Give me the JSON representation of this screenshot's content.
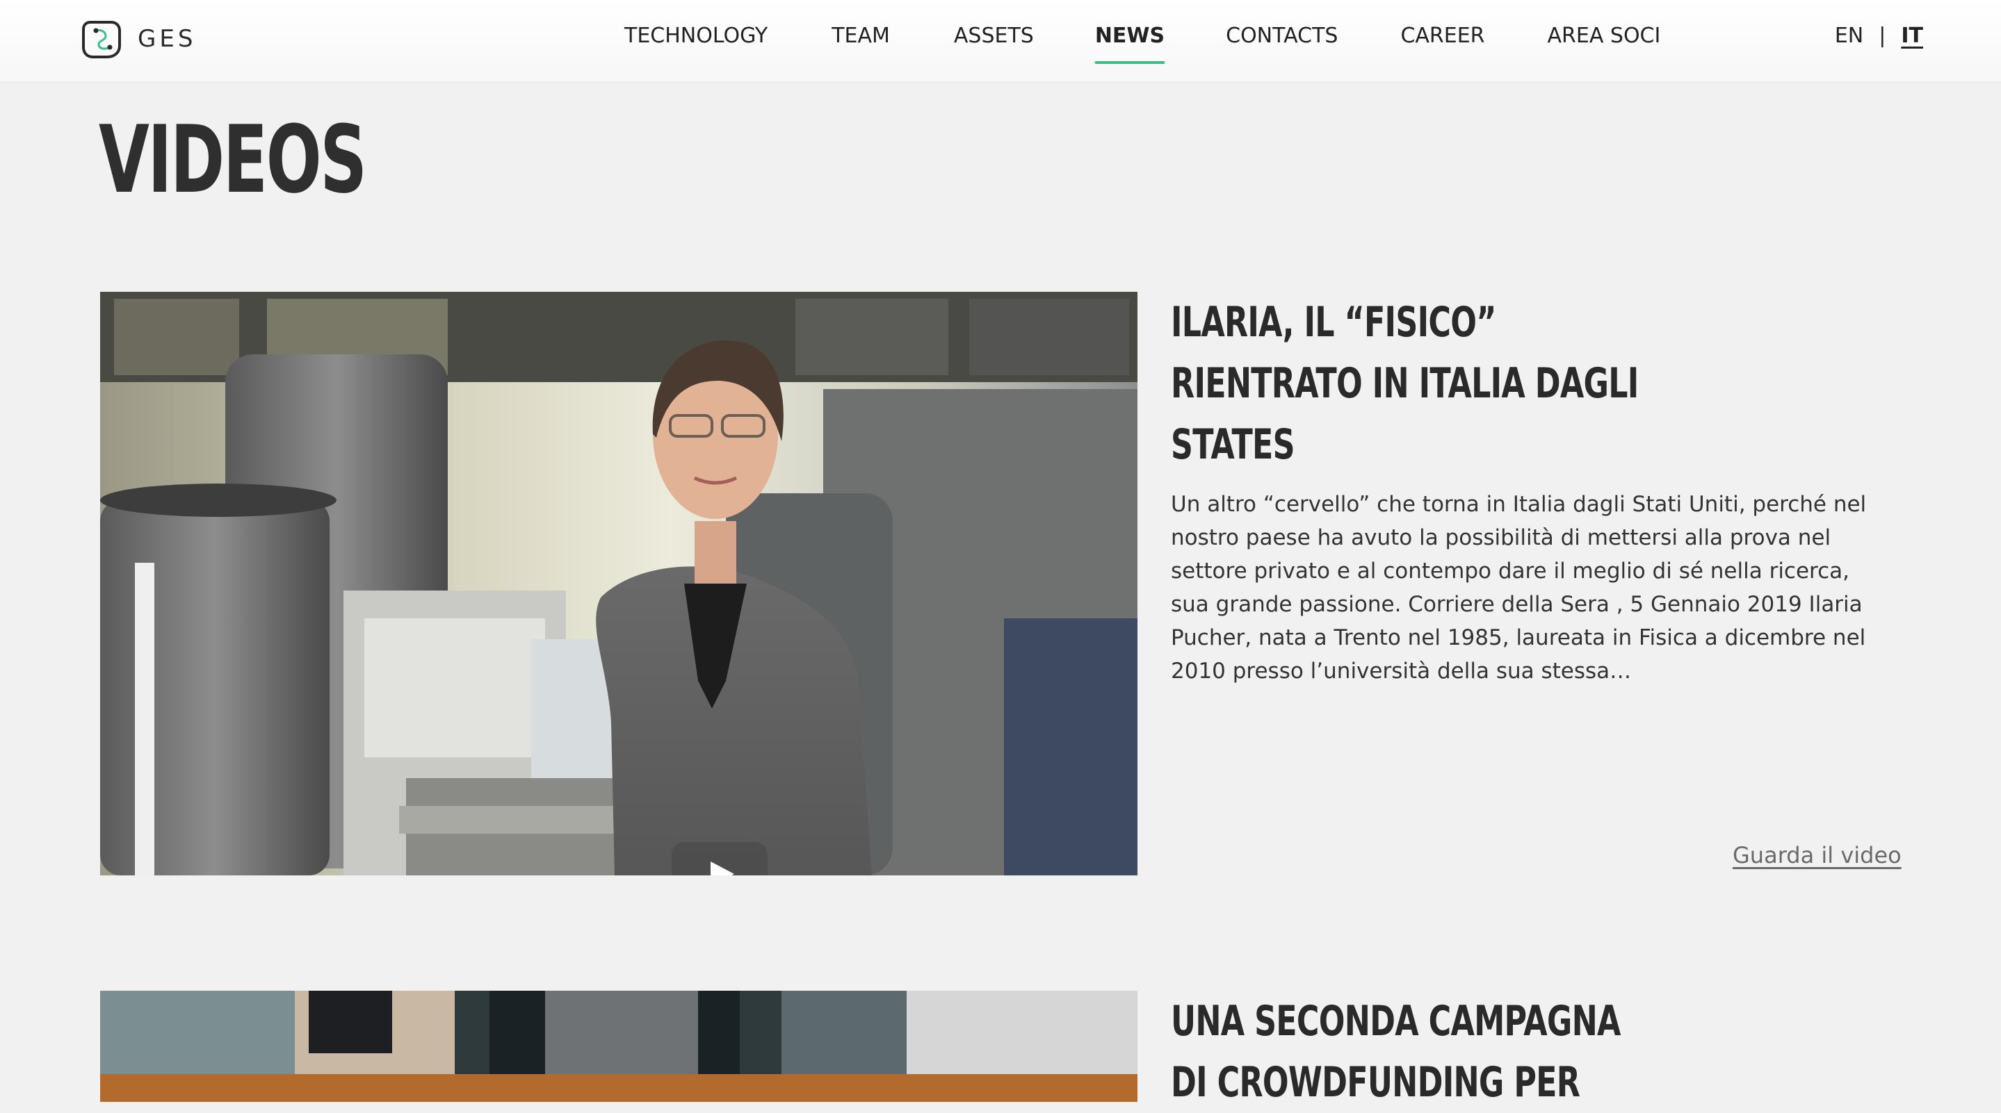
{
  "brand": {
    "name": "GES",
    "accent_color": "#3dbd86"
  },
  "nav": {
    "items": [
      {
        "label": "TECHNOLOGY"
      },
      {
        "label": "TEAM"
      },
      {
        "label": "ASSETS"
      },
      {
        "label": "NEWS",
        "active": true
      },
      {
        "label": "CONTACTS"
      },
      {
        "label": "CAREER"
      },
      {
        "label": "AREA SOCI"
      }
    ]
  },
  "lang": {
    "en": "EN",
    "separator": "|",
    "it": "IT",
    "active": "IT"
  },
  "page": {
    "title": "VIDEOS"
  },
  "videos": [
    {
      "title_lines": [
        "ILARIA, IL “FISICO”",
        "RIENTRATO IN ITALIA DAGLI",
        "STATES"
      ],
      "excerpt": "Un altro “cervello” che torna in Italia dagli Stati Uniti, perché nel nostro paese ha avuto la possibilità di mettersi alla prova nel settore privato e al contempo dare il meglio di sé nella ricerca, sua grande passione. Corriere della Sera , 5 Gennaio 2019 Ilaria Pucher, nata a Trento nel 1985, laureata in Fisica a dicembre nel 2010 presso l’università della sua stessa…",
      "link_label": "Guarda il video",
      "thumbnail_icon": "play-icon"
    },
    {
      "title_lines": [
        "UNA SECONDA CAMPAGNA",
        "DI CROWDFUNDING PER"
      ]
    }
  ]
}
